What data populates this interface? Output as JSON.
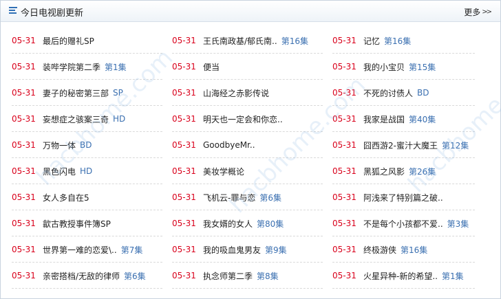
{
  "header": {
    "title": "今日电视剧更新",
    "more_label": "更多",
    "more_arrows": ">>"
  },
  "columns": [
    [
      {
        "date": "05-31",
        "name": "最后的赠礼SP",
        "ep": ""
      },
      {
        "date": "05-31",
        "name": "装哔学院第二季",
        "ep": "第1集"
      },
      {
        "date": "05-31",
        "name": "妻子的秘密第三部",
        "ep": "SP"
      },
      {
        "date": "05-31",
        "name": "妄想症之骇案三奇",
        "ep": "HD"
      },
      {
        "date": "05-31",
        "name": "万物一体",
        "ep": "BD"
      },
      {
        "date": "05-31",
        "name": "黑色闪电",
        "ep": "HD"
      },
      {
        "date": "05-31",
        "name": "女人多自在5",
        "ep": ""
      },
      {
        "date": "05-31",
        "name": "歙古教授事件簿SP",
        "ep": ""
      },
      {
        "date": "05-31",
        "name": "世界第一难的恋爱\\..",
        "ep": "第7集"
      },
      {
        "date": "05-31",
        "name": "亲密搭档/无敌的律师",
        "ep": "第6集"
      }
    ],
    [
      {
        "date": "05-31",
        "name": "王氏南政基/郁氏南..",
        "ep": "第16集"
      },
      {
        "date": "05-31",
        "name": "便当",
        "ep": ""
      },
      {
        "date": "05-31",
        "name": "山海经之赤影传说",
        "ep": ""
      },
      {
        "date": "05-31",
        "name": "明天也一定会和你恋..",
        "ep": ""
      },
      {
        "date": "05-31",
        "name": "GoodbyeMr..",
        "ep": ""
      },
      {
        "date": "05-31",
        "name": "美妆学概论",
        "ep": ""
      },
      {
        "date": "05-31",
        "name": "飞机云-罪与恋",
        "ep": "第6集"
      },
      {
        "date": "05-31",
        "name": "我女婿的女人",
        "ep": "第80集"
      },
      {
        "date": "05-31",
        "name": "我的吸血鬼男友",
        "ep": "第9集"
      },
      {
        "date": "05-31",
        "name": "执念师第二季",
        "ep": "第8集"
      }
    ],
    [
      {
        "date": "05-31",
        "name": "记忆",
        "ep": "第16集"
      },
      {
        "date": "05-31",
        "name": "我的小宝贝",
        "ep": "第15集"
      },
      {
        "date": "05-31",
        "name": "不死的讨债人",
        "ep": "BD"
      },
      {
        "date": "05-31",
        "name": "我家是战国",
        "ep": "第40集"
      },
      {
        "date": "05-31",
        "name": "囧西游2-蜜汁大魔王",
        "ep": "第12集"
      },
      {
        "date": "05-31",
        "name": "黑狐之风影",
        "ep": "第26集"
      },
      {
        "date": "05-31",
        "name": "阿浅来了特别篇之破..",
        "ep": ""
      },
      {
        "date": "05-31",
        "name": "不是每个小孩都不爱..",
        "ep": "第3集"
      },
      {
        "date": "05-31",
        "name": "终极游侠",
        "ep": "第16集"
      },
      {
        "date": "05-31",
        "name": "火星异种-新的希望..",
        "ep": "第1集"
      }
    ]
  ],
  "watermarks": [
    "hacbhome.com",
    "hacbhome.com",
    "hacbhome.com"
  ]
}
